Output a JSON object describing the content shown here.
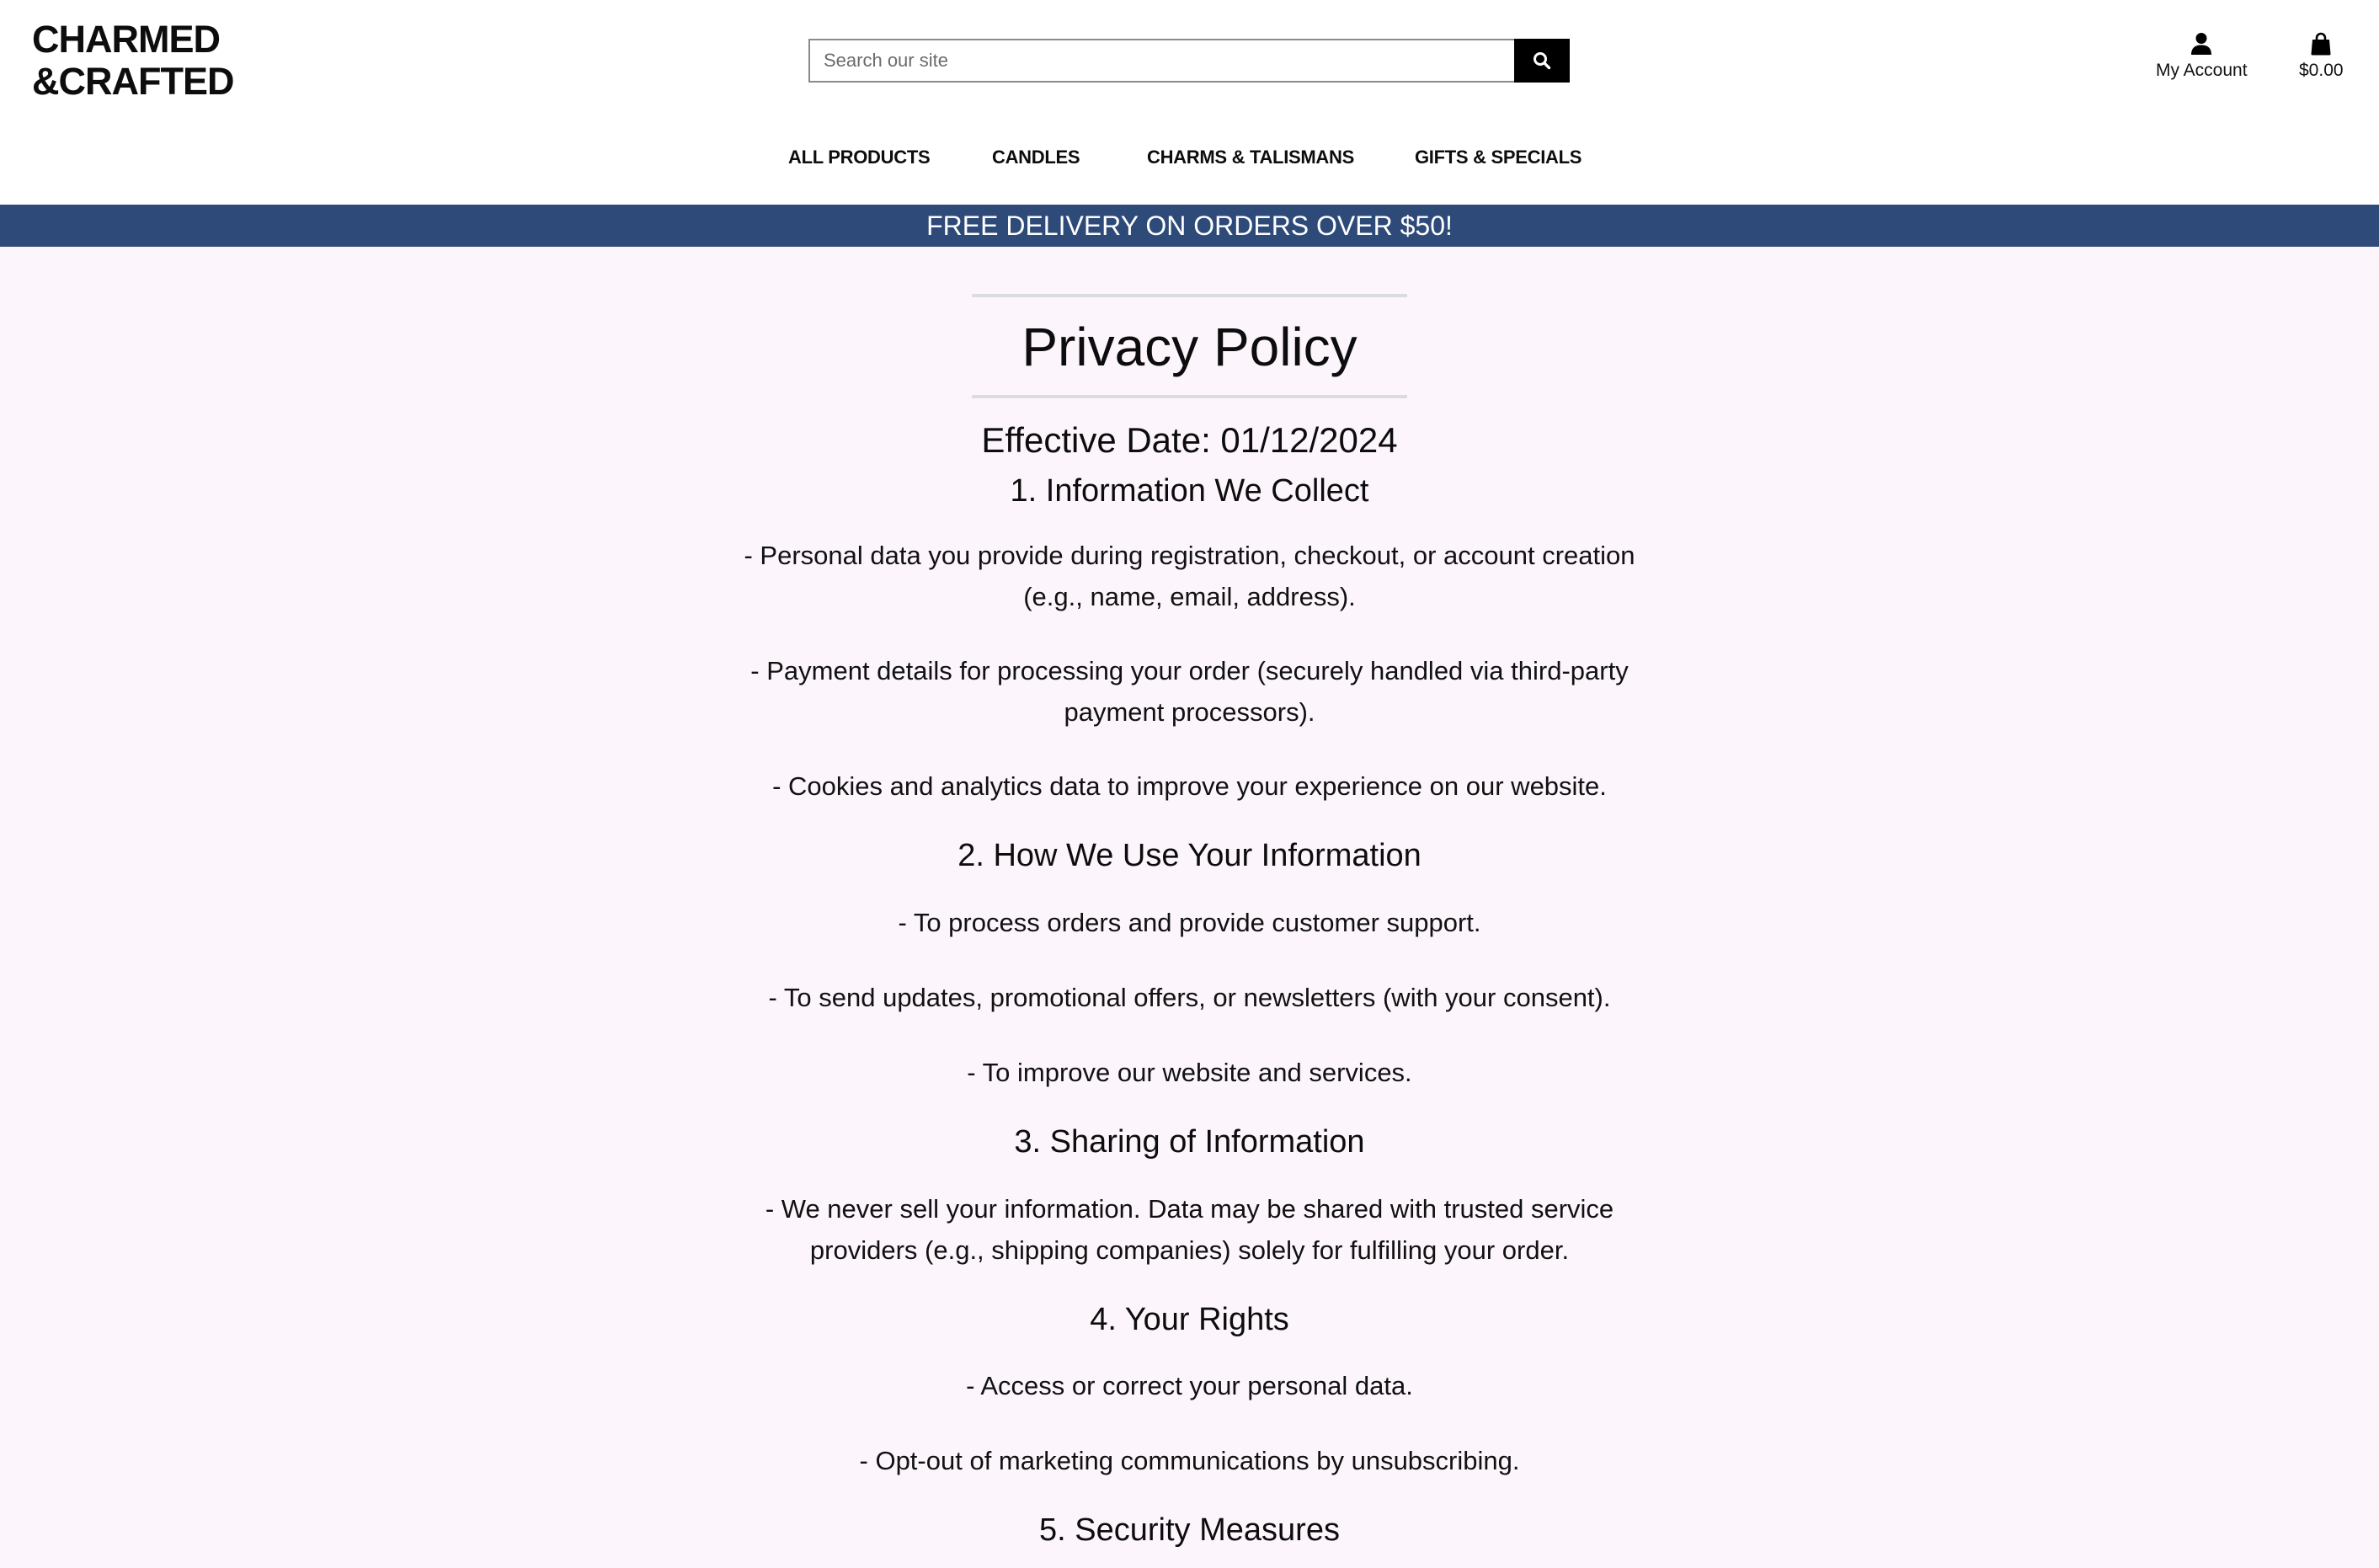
{
  "brand": {
    "logo_line1": "CHARMED",
    "logo_line2": "&CRAFTED"
  },
  "search": {
    "placeholder": "Search our site",
    "button_icon": "search-icon"
  },
  "header_actions": {
    "account_label": "My Account",
    "account_icon": "user-icon",
    "cart_total": "$0.00",
    "cart_icon": "shopping-bag-icon"
  },
  "nav": {
    "items": [
      "ALL PRODUCTS",
      "CANDLES",
      "CHARMS & TALISMANS",
      "GIFTS & SPECIALS"
    ]
  },
  "banner": {
    "text": "FREE DELIVERY ON ORDERS OVER $50!",
    "color": "#2e4a79"
  },
  "policy": {
    "title": "Privacy Policy",
    "effective_date": "Effective Date: 01/12/2024",
    "sections": [
      {
        "heading": "1. Information We Collect",
        "items": [
          "- Personal data you provide during registration, checkout, or account creation (e.g., name, email, address).",
          "- Payment details for processing your order (securely handled via third-party payment processors).",
          "- Cookies and analytics data to improve your experience on our website."
        ]
      },
      {
        "heading": "2. How We Use Your Information",
        "items": [
          "- To process orders and provide customer support.",
          "- To send updates, promotional offers, or newsletters (with your consent).",
          "- To improve our website and services."
        ]
      },
      {
        "heading": "3. Sharing of Information",
        "items": [
          "- We never sell your information. Data may be shared with trusted service providers (e.g., shipping companies) solely for fulfilling your order."
        ]
      },
      {
        "heading": "4. Your Rights",
        "items": [
          "- Access or correct your personal data.",
          "- Opt-out of marketing communications by unsubscribing."
        ]
      },
      {
        "heading": "5. Security Measures",
        "items": []
      }
    ]
  }
}
